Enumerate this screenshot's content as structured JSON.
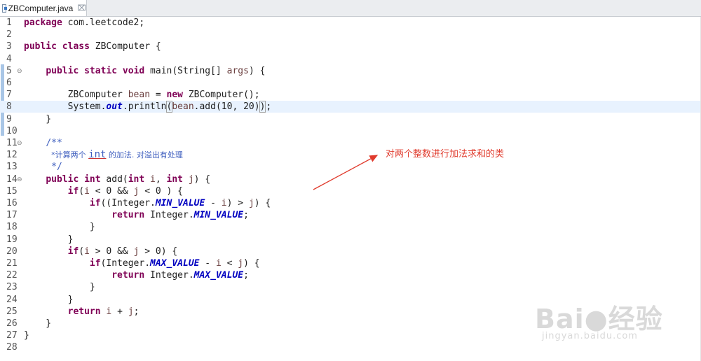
{
  "tab": {
    "title": "ZBComputer.java",
    "close_glyph": "⌧"
  },
  "annotation": {
    "text": "对两个整数进行加法求和的类",
    "color": "#e03a2c"
  },
  "watermark": {
    "brand": "Bai●经验",
    "site": "jingyan.baidu.com"
  },
  "lines": [
    {
      "num": "1",
      "fold": false,
      "segs": [
        {
          "t": "package",
          "c": "kw"
        },
        {
          "t": " com.leetcode2;"
        }
      ]
    },
    {
      "num": "2",
      "fold": false,
      "segs": []
    },
    {
      "num": "3",
      "fold": false,
      "segs": [
        {
          "t": "public",
          "c": "kw"
        },
        {
          "t": " "
        },
        {
          "t": "class",
          "c": "kw"
        },
        {
          "t": " ZBComputer {"
        }
      ]
    },
    {
      "num": "4",
      "fold": false,
      "segs": []
    },
    {
      "num": "5",
      "fold": true,
      "segs": [
        {
          "t": "    "
        },
        {
          "t": "public",
          "c": "kw"
        },
        {
          "t": " "
        },
        {
          "t": "static",
          "c": "kw"
        },
        {
          "t": " "
        },
        {
          "t": "void",
          "c": "kw"
        },
        {
          "t": " main(String[] "
        },
        {
          "t": "args",
          "c": "local"
        },
        {
          "t": ") {"
        }
      ]
    },
    {
      "num": "6",
      "fold": false,
      "segs": []
    },
    {
      "num": "7",
      "fold": false,
      "segs": [
        {
          "t": "        ZBComputer "
        },
        {
          "t": "bean",
          "c": "local"
        },
        {
          "t": " = "
        },
        {
          "t": "new",
          "c": "kw"
        },
        {
          "t": " ZBComputer();"
        }
      ]
    },
    {
      "num": "8",
      "fold": false,
      "hl": true,
      "segs": [
        {
          "t": "        System."
        },
        {
          "t": "out",
          "c": "static-field"
        },
        {
          "t": ".println"
        },
        {
          "t": "(",
          "c": "bracket"
        },
        {
          "t": "bean",
          "c": "local"
        },
        {
          "t": ".add(10, 20)"
        },
        {
          "t": ")",
          "c": "bracket"
        },
        {
          "t": "",
          "c": "caret"
        },
        {
          "t": ";"
        }
      ]
    },
    {
      "num": "9",
      "fold": false,
      "segs": [
        {
          "t": "    }"
        }
      ]
    },
    {
      "num": "10",
      "fold": false,
      "segs": []
    },
    {
      "num": "11",
      "fold": true,
      "segs": [
        {
          "t": "    "
        },
        {
          "t": "/**",
          "c": "doc"
        }
      ]
    },
    {
      "num": "12",
      "fold": false,
      "segs": [
        {
          "t": "     "
        },
        {
          "t": "*计算两个 ",
          "c": "doc-cn"
        },
        {
          "t": "int",
          "c": "doc-int"
        },
        {
          "t": " 的加法. 对溢出有处理",
          "c": "doc-cn"
        }
      ]
    },
    {
      "num": "13",
      "fold": false,
      "segs": [
        {
          "t": "     "
        },
        {
          "t": "*/",
          "c": "doc"
        }
      ]
    },
    {
      "num": "14",
      "fold": true,
      "segs": [
        {
          "t": "    "
        },
        {
          "t": "public",
          "c": "kw"
        },
        {
          "t": " "
        },
        {
          "t": "int",
          "c": "kw"
        },
        {
          "t": " add("
        },
        {
          "t": "int",
          "c": "kw"
        },
        {
          "t": " "
        },
        {
          "t": "i",
          "c": "local"
        },
        {
          "t": ", "
        },
        {
          "t": "int",
          "c": "kw"
        },
        {
          "t": " "
        },
        {
          "t": "j",
          "c": "local"
        },
        {
          "t": ") {"
        }
      ]
    },
    {
      "num": "15",
      "fold": false,
      "segs": [
        {
          "t": "        "
        },
        {
          "t": "if",
          "c": "kw"
        },
        {
          "t": "("
        },
        {
          "t": "i",
          "c": "local"
        },
        {
          "t": " < 0 && "
        },
        {
          "t": "j",
          "c": "local"
        },
        {
          "t": " < 0 ) {"
        }
      ]
    },
    {
      "num": "16",
      "fold": false,
      "segs": [
        {
          "t": "            "
        },
        {
          "t": "if",
          "c": "kw"
        },
        {
          "t": "((Integer."
        },
        {
          "t": "MIN_VALUE",
          "c": "static-field"
        },
        {
          "t": " - "
        },
        {
          "t": "i",
          "c": "local"
        },
        {
          "t": ") > "
        },
        {
          "t": "j",
          "c": "local"
        },
        {
          "t": ") {"
        }
      ]
    },
    {
      "num": "17",
      "fold": false,
      "segs": [
        {
          "t": "                "
        },
        {
          "t": "return",
          "c": "kw"
        },
        {
          "t": " Integer."
        },
        {
          "t": "MIN_VALUE",
          "c": "static-field"
        },
        {
          "t": ";"
        }
      ]
    },
    {
      "num": "18",
      "fold": false,
      "segs": [
        {
          "t": "            }"
        }
      ]
    },
    {
      "num": "19",
      "fold": false,
      "segs": [
        {
          "t": "        }"
        }
      ]
    },
    {
      "num": "20",
      "fold": false,
      "segs": [
        {
          "t": "        "
        },
        {
          "t": "if",
          "c": "kw"
        },
        {
          "t": "("
        },
        {
          "t": "i",
          "c": "local"
        },
        {
          "t": " > 0 && "
        },
        {
          "t": "j",
          "c": "local"
        },
        {
          "t": " > 0) {"
        }
      ]
    },
    {
      "num": "21",
      "fold": false,
      "segs": [
        {
          "t": "            "
        },
        {
          "t": "if",
          "c": "kw"
        },
        {
          "t": "(Integer."
        },
        {
          "t": "MAX_VALUE",
          "c": "static-field"
        },
        {
          "t": " - "
        },
        {
          "t": "i",
          "c": "local"
        },
        {
          "t": " < "
        },
        {
          "t": "j",
          "c": "local"
        },
        {
          "t": ") {"
        }
      ]
    },
    {
      "num": "22",
      "fold": false,
      "segs": [
        {
          "t": "                "
        },
        {
          "t": "return",
          "c": "kw"
        },
        {
          "t": " Integer."
        },
        {
          "t": "MAX_VALUE",
          "c": "static-field"
        },
        {
          "t": ";"
        }
      ]
    },
    {
      "num": "23",
      "fold": false,
      "segs": [
        {
          "t": "            }"
        }
      ]
    },
    {
      "num": "24",
      "fold": false,
      "segs": [
        {
          "t": "        }"
        }
      ]
    },
    {
      "num": "25",
      "fold": false,
      "segs": [
        {
          "t": "        "
        },
        {
          "t": "return",
          "c": "kw"
        },
        {
          "t": " "
        },
        {
          "t": "i",
          "c": "local"
        },
        {
          "t": " + "
        },
        {
          "t": "j",
          "c": "local"
        },
        {
          "t": ";"
        }
      ]
    },
    {
      "num": "26",
      "fold": false,
      "segs": [
        {
          "t": "    }"
        }
      ]
    },
    {
      "num": "27",
      "fold": false,
      "segs": [
        {
          "t": "}"
        }
      ]
    },
    {
      "num": "28",
      "fold": false,
      "segs": []
    }
  ]
}
